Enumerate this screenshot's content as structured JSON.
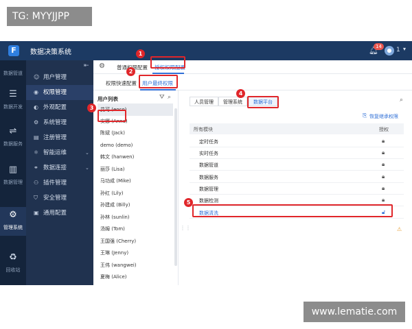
{
  "watermarks": {
    "top": "TG: MYYJJPP",
    "bottom": "www.lematie.com"
  },
  "topbar": {
    "app_title": "数据决策系统",
    "notification_count": "14",
    "user_count": "1"
  },
  "rail": {
    "items": [
      {
        "label": "数据管道",
        "icon": "pipeline-icon"
      },
      {
        "label": "数据开发",
        "icon": "develop-icon"
      },
      {
        "label": "数据服务",
        "icon": "service-icon"
      },
      {
        "label": "数据管理",
        "icon": "manage-icon"
      },
      {
        "label": "管理系统",
        "icon": "gear-icon"
      },
      {
        "label": "回收站",
        "icon": "recycle-icon"
      }
    ]
  },
  "sidebar": {
    "items": [
      {
        "label": "用户管理",
        "icon": "user-icon"
      },
      {
        "label": "权限管理",
        "icon": "permission-icon"
      },
      {
        "label": "外观配置",
        "icon": "palette-icon"
      },
      {
        "label": "系统管理",
        "icon": "settings-icon"
      },
      {
        "label": "注册管理",
        "icon": "register-icon"
      },
      {
        "label": "智能运维",
        "icon": "ops-icon"
      },
      {
        "label": "数据连接",
        "icon": "connection-icon"
      },
      {
        "label": "插件管理",
        "icon": "plugin-icon"
      },
      {
        "label": "安全管理",
        "icon": "shield-icon"
      },
      {
        "label": "通用配置",
        "icon": "config-icon"
      }
    ]
  },
  "tabs_level1": {
    "normal": "普通权限配置",
    "grant": "授权权限配置"
  },
  "tabs_level2": {
    "quick": "权限快速配置",
    "final": "用户最终权限"
  },
  "user_list": {
    "title": "用户列表",
    "users": [
      "艾可 (eoco)",
      "安娜 (Anna)",
      "陈斌 (Jack)",
      "demo (demo)",
      "韩文 (hanwen)",
      "丽莎 (Lisa)",
      "马功成 (Mike)",
      "孙红 (Lily)",
      "孙建成 (Billy)",
      "孙林 (sunlin)",
      "汤姆 (Tom)",
      "王国强 (Cherry)",
      "王琳 (Jenny)",
      "王伟 (wangwei)",
      "夏梅 (Alice)"
    ]
  },
  "right_tabs": {
    "personnel": "人员管理",
    "system": "管理系统",
    "platform": "数据平台"
  },
  "restore_label": "恢复继承权限",
  "table": {
    "col_module": "所有模块",
    "col_auth": "授权",
    "rows": [
      "定时任务",
      "实时任务",
      "数据管道",
      "数据服务",
      "数据管理",
      "数据检测",
      "数据清洗"
    ]
  },
  "step_markers": [
    "1",
    "2",
    "3",
    "4",
    "5"
  ]
}
